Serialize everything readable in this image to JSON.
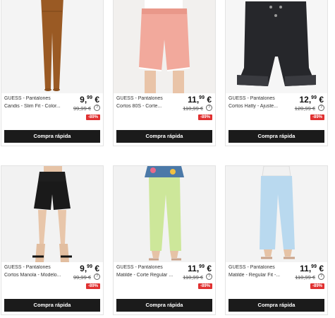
{
  "products": [
    {
      "brand": "GUESS - Pantalones",
      "name": "Candis - Slim Fit - Color...",
      "price_int": "9,",
      "price_cents": "99",
      "currency": "€",
      "old_price": "99,99 €",
      "discount": "-89%",
      "buy_label": "Compra rápida",
      "image": "brown-slim-trousers"
    },
    {
      "brand": "GUESS - Pantalones",
      "name": "Cortos 80S - Corte...",
      "price_int": "11,",
      "price_cents": "99",
      "currency": "€",
      "old_price": "110,99 €",
      "discount": "-89%",
      "buy_label": "Compra rápida",
      "image": "pink-denim-shorts"
    },
    {
      "brand": "GUESS - Pantalones",
      "name": "Cortos Hatty - Ajuste...",
      "price_int": "12,",
      "price_cents": "99",
      "currency": "€",
      "old_price": "120,99 €",
      "discount": "-89%",
      "buy_label": "Compra rápida",
      "image": "black-denim-shorts"
    },
    {
      "brand": "GUESS - Pantalones",
      "name": "Cortos Manola - Modelo...",
      "price_int": "9,",
      "price_cents": "99",
      "currency": "€",
      "old_price": "99,99 €",
      "discount": "-89%",
      "buy_label": "Compra rápida",
      "image": "black-shorts-model"
    },
    {
      "brand": "GUESS - Pantalones",
      "name": "Matilde - Corte Regular ...",
      "price_int": "11,",
      "price_cents": "99",
      "currency": "€",
      "old_price": "110,99 €",
      "discount": "-89%",
      "buy_label": "Compra rápida",
      "image": "green-trousers-model"
    },
    {
      "brand": "GUESS - Pantalones",
      "name": "Matilde - Regular Fit -...",
      "price_int": "11,",
      "price_cents": "99",
      "currency": "€",
      "old_price": "110,99 €",
      "discount": "-89%",
      "buy_label": "Compra rápida",
      "image": "light-blue-trousers-model"
    }
  ],
  "info_glyph": "?"
}
